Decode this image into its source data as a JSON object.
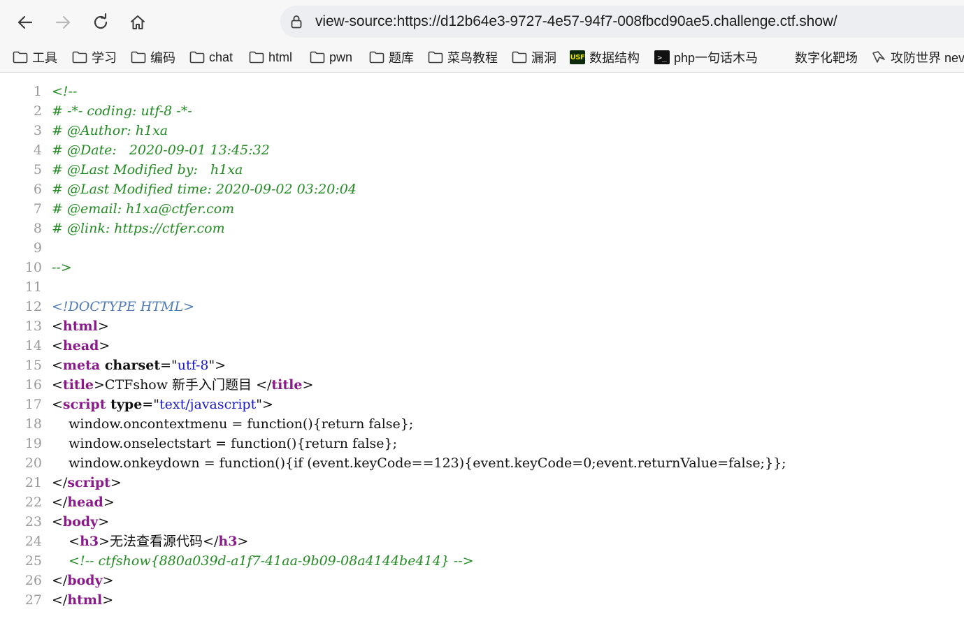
{
  "toolbar": {
    "back_icon": "arrow-left-icon",
    "forward_icon": "arrow-right-icon",
    "reload_icon": "reload-icon",
    "home_icon": "home-icon",
    "lock_icon": "lock-icon",
    "url": "view-source:https://d12b64e3-9727-4e57-94f7-008fbcd90ae5.challenge.ctf.show/"
  },
  "bookmarks": [
    {
      "label": "工具",
      "icon": "folder-icon"
    },
    {
      "label": "学习",
      "icon": "folder-icon"
    },
    {
      "label": "编码",
      "icon": "folder-icon"
    },
    {
      "label": "chat",
      "icon": "folder-icon"
    },
    {
      "label": "html",
      "icon": "folder-icon"
    },
    {
      "label": "pwn",
      "icon": "folder-icon"
    },
    {
      "label": "题库",
      "icon": "folder-icon"
    },
    {
      "label": "菜鸟教程",
      "icon": "folder-icon"
    },
    {
      "label": "漏洞",
      "icon": "folder-icon"
    },
    {
      "label": "数据结构",
      "icon": "usf-icon",
      "icon_text": "USF"
    },
    {
      "label": "php一句话木马",
      "icon": "terminal-icon",
      "icon_text": ">_"
    },
    {
      "label": "数字化靶场",
      "icon": "none"
    },
    {
      "label": "攻防世界 nev",
      "icon": "site-icon"
    }
  ],
  "colors": {
    "comment": "#238b23",
    "doctype": "#4f7bb8",
    "tag": "#8a1a8a",
    "attr_value": "#1a1ac8",
    "line_number": "#9a9a9a"
  },
  "source": {
    "lines": [
      {
        "n": "1",
        "segments": [
          {
            "t": "<!--",
            "c": "comment"
          }
        ]
      },
      {
        "n": "2",
        "segments": [
          {
            "t": "# -*- coding: utf-8 -*-",
            "c": "comment"
          }
        ]
      },
      {
        "n": "3",
        "segments": [
          {
            "t": "# @Author: h1xa",
            "c": "comment"
          }
        ]
      },
      {
        "n": "4",
        "segments": [
          {
            "t": "# @Date:   2020-09-01 13:45:32",
            "c": "comment"
          }
        ]
      },
      {
        "n": "5",
        "segments": [
          {
            "t": "# @Last Modified by:   h1xa",
            "c": "comment"
          }
        ]
      },
      {
        "n": "6",
        "segments": [
          {
            "t": "# @Last Modified time: 2020-09-02 03:20:04",
            "c": "comment"
          }
        ]
      },
      {
        "n": "7",
        "segments": [
          {
            "t": "# @email: h1xa@ctfer.com",
            "c": "comment"
          }
        ]
      },
      {
        "n": "8",
        "segments": [
          {
            "t": "# @link: https://ctfer.com",
            "c": "comment"
          }
        ]
      },
      {
        "n": "9",
        "segments": []
      },
      {
        "n": "10",
        "segments": [
          {
            "t": "-->",
            "c": "comment"
          }
        ]
      },
      {
        "n": "11",
        "segments": []
      },
      {
        "n": "12",
        "segments": [
          {
            "t": "<!DOCTYPE HTML>",
            "c": "doctype"
          }
        ]
      },
      {
        "n": "13",
        "segments": [
          {
            "t": "<",
            "c": "punct"
          },
          {
            "t": "html",
            "c": "tag"
          },
          {
            "t": ">",
            "c": "punct"
          }
        ]
      },
      {
        "n": "14",
        "segments": [
          {
            "t": "<",
            "c": "punct"
          },
          {
            "t": "head",
            "c": "tag"
          },
          {
            "t": ">",
            "c": "punct"
          }
        ]
      },
      {
        "n": "15",
        "segments": [
          {
            "t": "<",
            "c": "punct"
          },
          {
            "t": "meta ",
            "c": "tag"
          },
          {
            "t": "charset",
            "c": "attr"
          },
          {
            "t": "=\"",
            "c": "punct"
          },
          {
            "t": "utf-8",
            "c": "val"
          },
          {
            "t": "\">",
            "c": "punct"
          }
        ]
      },
      {
        "n": "16",
        "segments": [
          {
            "t": "<",
            "c": "punct"
          },
          {
            "t": "title",
            "c": "tag"
          },
          {
            "t": ">CTFshow 新手入门题目 </",
            "c": "punct"
          },
          {
            "t": "title",
            "c": "tag"
          },
          {
            "t": ">",
            "c": "punct"
          }
        ]
      },
      {
        "n": "17",
        "segments": [
          {
            "t": "<",
            "c": "punct"
          },
          {
            "t": "script ",
            "c": "tag"
          },
          {
            "t": "type",
            "c": "attr"
          },
          {
            "t": "=\"",
            "c": "punct"
          },
          {
            "t": "text/javascript",
            "c": "val"
          },
          {
            "t": "\">",
            "c": "punct"
          }
        ]
      },
      {
        "n": "18",
        "segments": [
          {
            "t": "    window.oncontextmenu = function(){return false};",
            "c": "punct"
          }
        ]
      },
      {
        "n": "19",
        "segments": [
          {
            "t": "    window.onselectstart = function(){return false};",
            "c": "punct"
          }
        ]
      },
      {
        "n": "20",
        "segments": [
          {
            "t": "    window.onkeydown = function(){if (event.keyCode==123){event.keyCode=0;event.returnValue=false;}};",
            "c": "punct"
          }
        ]
      },
      {
        "n": "21",
        "segments": [
          {
            "t": "</",
            "c": "punct"
          },
          {
            "t": "script",
            "c": "tag"
          },
          {
            "t": ">",
            "c": "punct"
          }
        ]
      },
      {
        "n": "22",
        "segments": [
          {
            "t": "</",
            "c": "punct"
          },
          {
            "t": "head",
            "c": "tag"
          },
          {
            "t": ">",
            "c": "punct"
          }
        ]
      },
      {
        "n": "23",
        "segments": [
          {
            "t": "<",
            "c": "punct"
          },
          {
            "t": "body",
            "c": "tag"
          },
          {
            "t": ">",
            "c": "punct"
          }
        ]
      },
      {
        "n": "24",
        "segments": [
          {
            "t": "    <",
            "c": "punct"
          },
          {
            "t": "h3",
            "c": "tag"
          },
          {
            "t": ">无法查看源代码</",
            "c": "punct"
          },
          {
            "t": "h3",
            "c": "tag"
          },
          {
            "t": ">",
            "c": "punct"
          }
        ]
      },
      {
        "n": "25",
        "segments": [
          {
            "t": "    <!-- ctfshow{880a039d-a1f7-41aa-9b09-08a4144be414} -->",
            "c": "comment"
          }
        ]
      },
      {
        "n": "26",
        "segments": [
          {
            "t": "</",
            "c": "punct"
          },
          {
            "t": "body",
            "c": "tag"
          },
          {
            "t": ">",
            "c": "punct"
          }
        ]
      },
      {
        "n": "27",
        "segments": [
          {
            "t": "</",
            "c": "punct"
          },
          {
            "t": "html",
            "c": "tag"
          },
          {
            "t": ">",
            "c": "punct"
          }
        ]
      }
    ]
  }
}
